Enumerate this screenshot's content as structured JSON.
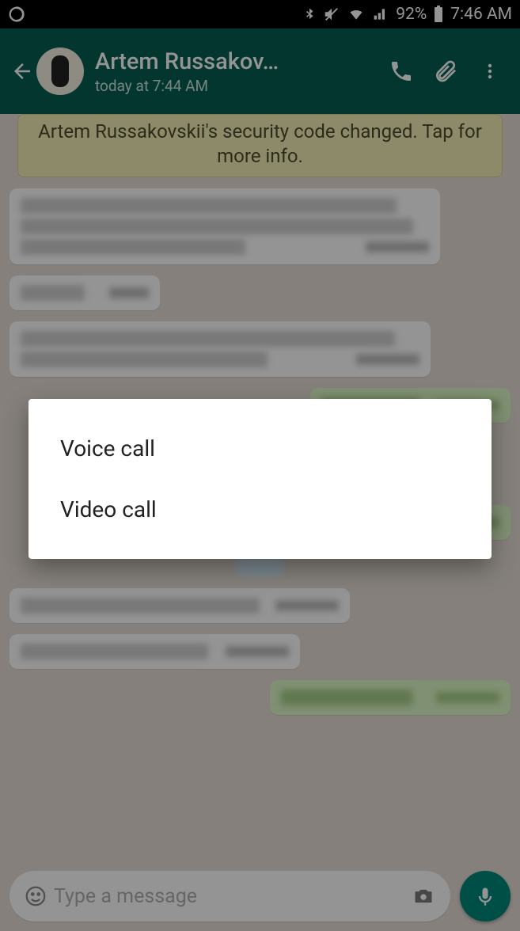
{
  "status_bar": {
    "battery_percent": "92%",
    "time": "7:46 AM"
  },
  "header": {
    "contact_name": "Artem Russakov…",
    "last_seen": "today at 7:44 AM"
  },
  "security_notice": "Artem Russakovskii's security code changed. Tap for more info.",
  "dialog": {
    "options": [
      {
        "label": "Voice call"
      },
      {
        "label": "Video call"
      }
    ]
  },
  "input": {
    "placeholder": "Type a message"
  }
}
